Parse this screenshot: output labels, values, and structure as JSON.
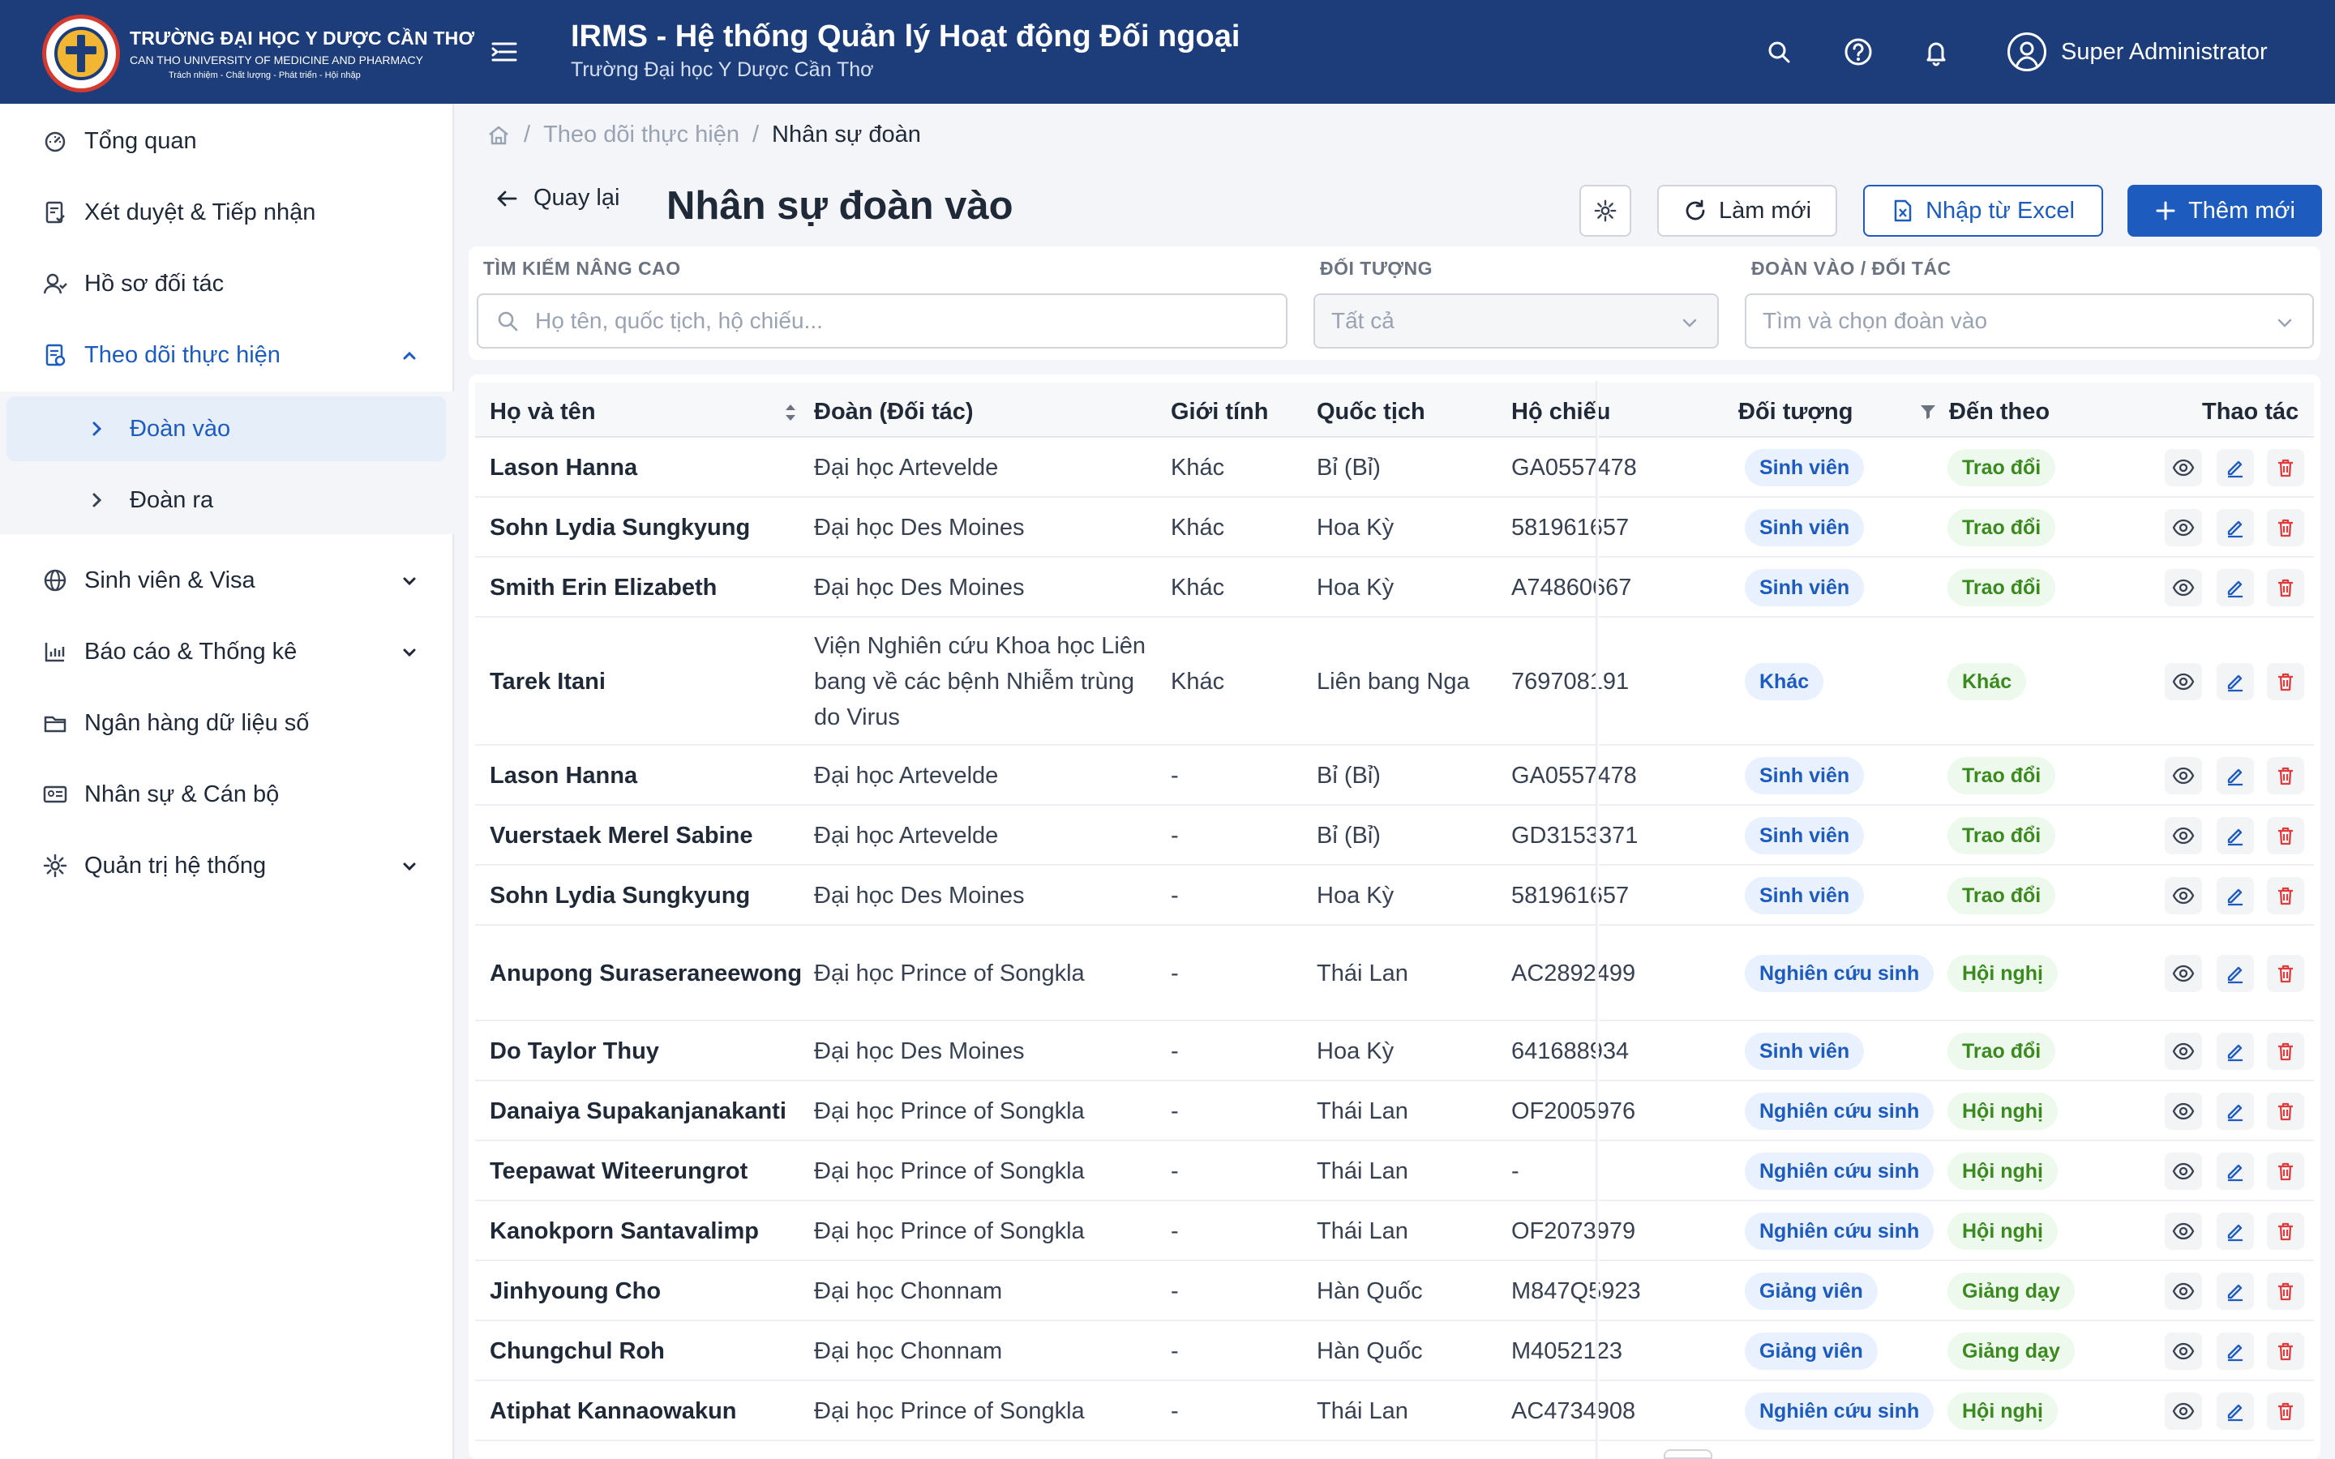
{
  "header": {
    "logo_line1": "TRƯỜNG ĐẠI HỌC Y DƯỢC CẦN THƠ",
    "logo_line2": "CAN THO UNIVERSITY OF MEDICINE AND PHARMACY",
    "logo_line3": "Trách nhiệm - Chất lượng - Phát triển - Hội nhập",
    "app_title": "IRMS - Hệ thống Quản lý Hoạt động Đối ngoại",
    "app_subtitle": "Trường Đại học Y Dược Cần Thơ",
    "user_name": "Super Administrator",
    "brand_color": "#1c3d7a",
    "icons": [
      "menu-icon",
      "search-icon",
      "help-icon",
      "bell-icon",
      "user-icon"
    ]
  },
  "sidebar": {
    "items": [
      {
        "label": "Tổng quan",
        "icon": "dashboard-icon"
      },
      {
        "label": "Xét duyệt & Tiếp nhận",
        "icon": "checklist-icon"
      },
      {
        "label": "Hồ sơ đối tác",
        "icon": "partner-icon"
      },
      {
        "label": "Theo dõi thực hiện",
        "icon": "tracking-icon",
        "expanded": true
      },
      {
        "label": "Sinh viên & Visa",
        "icon": "globe-icon"
      },
      {
        "label": "Báo cáo & Thống kê",
        "icon": "chart-icon"
      },
      {
        "label": "Ngân hàng dữ liệu số",
        "icon": "folder-icon"
      },
      {
        "label": "Nhân sự & Cán bộ",
        "icon": "id-card-icon"
      },
      {
        "label": "Quản trị hệ thống",
        "icon": "gear-icon"
      }
    ],
    "sub_items": [
      {
        "label": "Đoàn vào",
        "selected": true
      },
      {
        "label": "Đoàn ra"
      }
    ]
  },
  "breadcrumb": {
    "parent": "Theo dõi thực hiện",
    "current": "Nhân sự đoàn"
  },
  "page": {
    "back_label": "Quay lại",
    "title": "Nhân sự đoàn vào",
    "refresh_label": "Làm mới",
    "import_label": "Nhập từ Excel",
    "add_label": "Thêm mới",
    "accent_color": "#1d5bbf"
  },
  "filters": {
    "search_label": "TÌM KIẾM NÂNG CAO",
    "search_placeholder": "Họ tên, quốc tịch, hộ chiếu...",
    "target_label": "ĐỐI TƯỢNG",
    "target_value": "Tất cả",
    "delegation_label": "ĐOÀN VÀO / ĐỐI TÁC",
    "delegation_placeholder": "Tìm và chọn đoàn vào"
  },
  "table": {
    "columns": [
      "Họ và tên",
      "Đoàn (Đối tác)",
      "Giới tính",
      "Quốc tịch",
      "Hộ chiếu",
      "Đối tượng",
      "Đến theo d",
      "Thao tác"
    ],
    "rows": [
      {
        "name": "Lason Hanna",
        "org": "Đại học Artevelde",
        "gender": "Khác",
        "nationality": "Bỉ (Bỉ)",
        "passport": "GA0557478",
        "target": "Sinh viên",
        "purpose": "Trao đổi"
      },
      {
        "name": "Sohn Lydia Sungkyung",
        "org": "Đại học Des Moines",
        "gender": "Khác",
        "nationality": "Hoa Kỳ",
        "passport": "581961657",
        "target": "Sinh viên",
        "purpose": "Trao đổi"
      },
      {
        "name": "Smith Erin Elizabeth",
        "org": "Đại học Des Moines",
        "gender": "Khác",
        "nationality": "Hoa Kỳ",
        "passport": "A74860667",
        "target": "Sinh viên",
        "purpose": "Trao đổi"
      },
      {
        "name": "Tarek Itani",
        "org": "Viện Nghiên cứu Khoa học Liên bang về các bệnh Nhiễm trùng do Virus",
        "gender": "Khác",
        "nationality": "Liên bang Nga",
        "passport": "769708191",
        "target": "Khác",
        "purpose": "Khác"
      },
      {
        "name": "Lason Hanna",
        "org": "Đại học Artevelde",
        "gender": "-",
        "nationality": "Bỉ (Bỉ)",
        "passport": "GA0557478",
        "target": "Sinh viên",
        "purpose": "Trao đổi"
      },
      {
        "name": "Vuerstaek Merel Sabine",
        "org": "Đại học Artevelde",
        "gender": "-",
        "nationality": "Bỉ (Bỉ)",
        "passport": "GD3153371",
        "target": "Sinh viên",
        "purpose": "Trao đổi"
      },
      {
        "name": "Sohn Lydia Sungkyung",
        "org": "Đại học Des Moines",
        "gender": "-",
        "nationality": "Hoa Kỳ",
        "passport": "581961657",
        "target": "Sinh viên",
        "purpose": "Trao đổi"
      },
      {
        "name": "Anupong Suraseraneewong",
        "org": "Đại học Prince of Songkla",
        "gender": "-",
        "nationality": "Thái Lan",
        "passport": "AC2892499",
        "target": "Nghiên cứu sinh",
        "purpose": "Hội nghị"
      },
      {
        "name": "Do Taylor Thuy",
        "org": "Đại học Des Moines",
        "gender": "-",
        "nationality": "Hoa Kỳ",
        "passport": "641688934",
        "target": "Sinh viên",
        "purpose": "Trao đổi"
      },
      {
        "name": "Danaiya Supakanjanakanti",
        "org": "Đại học Prince of Songkla",
        "gender": "-",
        "nationality": "Thái Lan",
        "passport": "OF2005976",
        "target": "Nghiên cứu sinh",
        "purpose": "Hội nghị"
      },
      {
        "name": "Teepawat Witeerungrot",
        "org": "Đại học Prince of Songkla",
        "gender": "-",
        "nationality": "Thái Lan",
        "passport": "-",
        "target": "Nghiên cứu sinh",
        "purpose": "Hội nghị"
      },
      {
        "name": "Kanokporn Santavalimp",
        "org": "Đại học Prince of Songkla",
        "gender": "-",
        "nationality": "Thái Lan",
        "passport": "OF2073979",
        "target": "Nghiên cứu sinh",
        "purpose": "Hội nghị"
      },
      {
        "name": "Jinhyoung Cho",
        "org": "Đại học Chonnam",
        "gender": "-",
        "nationality": "Hàn Quốc",
        "passport": "M847Q5923",
        "target": "Giảng viên",
        "purpose": "Giảng dạy"
      },
      {
        "name": "Chungchul Roh",
        "org": "Đại học Chonnam",
        "gender": "-",
        "nationality": "Hàn Quốc",
        "passport": "M4052123",
        "target": "Giảng viên",
        "purpose": "Giảng dạy"
      },
      {
        "name": "Atiphat Kannaowakun",
        "org": "Đại học Prince of Songkla",
        "gender": "-",
        "nationality": "Thái Lan",
        "passport": "AC4734908",
        "target": "Nghiên cứu sinh",
        "purpose": "Hội nghị"
      }
    ],
    "row_actions": [
      "view-icon",
      "edit-icon",
      "delete-icon"
    ]
  }
}
